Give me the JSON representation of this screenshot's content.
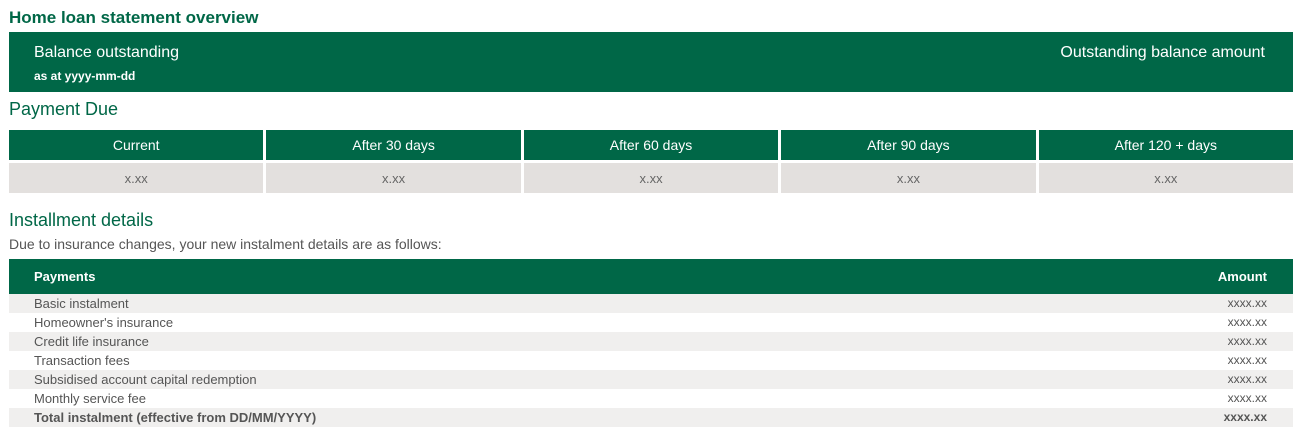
{
  "title": "Home loan statement overview",
  "balance": {
    "label": "Balance outstanding",
    "date": "as at yyyy-mm-dd",
    "amount": "Outstanding balance amount"
  },
  "payment_due": {
    "title": "Payment Due",
    "columns": [
      "Current",
      "After 30 days",
      "After 60 days",
      "After 90 days",
      "After 120 + days"
    ],
    "values": [
      "x.xx",
      "x.xx",
      "x.xx",
      "x.xx",
      "x.xx"
    ]
  },
  "installment": {
    "title": "Installment details",
    "subtitle": "Due to insurance changes, your new instalment details are as follows:",
    "header_payments": "Payments",
    "header_amount": "Amount",
    "rows": [
      {
        "label": "Basic instalment",
        "amount": "xxxx.xx"
      },
      {
        "label": "Homeowner's insurance",
        "amount": "xxxx.xx"
      },
      {
        "label": "Credit life insurance",
        "amount": "xxxx.xx"
      },
      {
        "label": "Transaction fees",
        "amount": "xxxx.xx"
      },
      {
        "label": "Subsidised account capital redemption",
        "amount": "xxxx.xx"
      },
      {
        "label": "Monthly service fee",
        "amount": "xxxx.xx"
      },
      {
        "label": "Total instalment (effective from DD/MM/YYYY)",
        "amount": "xxxx.xx"
      }
    ]
  },
  "colors": {
    "brand_green": "#006747",
    "value_cell_gray": "#e3e0de",
    "row_stripe": "#f0efee"
  }
}
